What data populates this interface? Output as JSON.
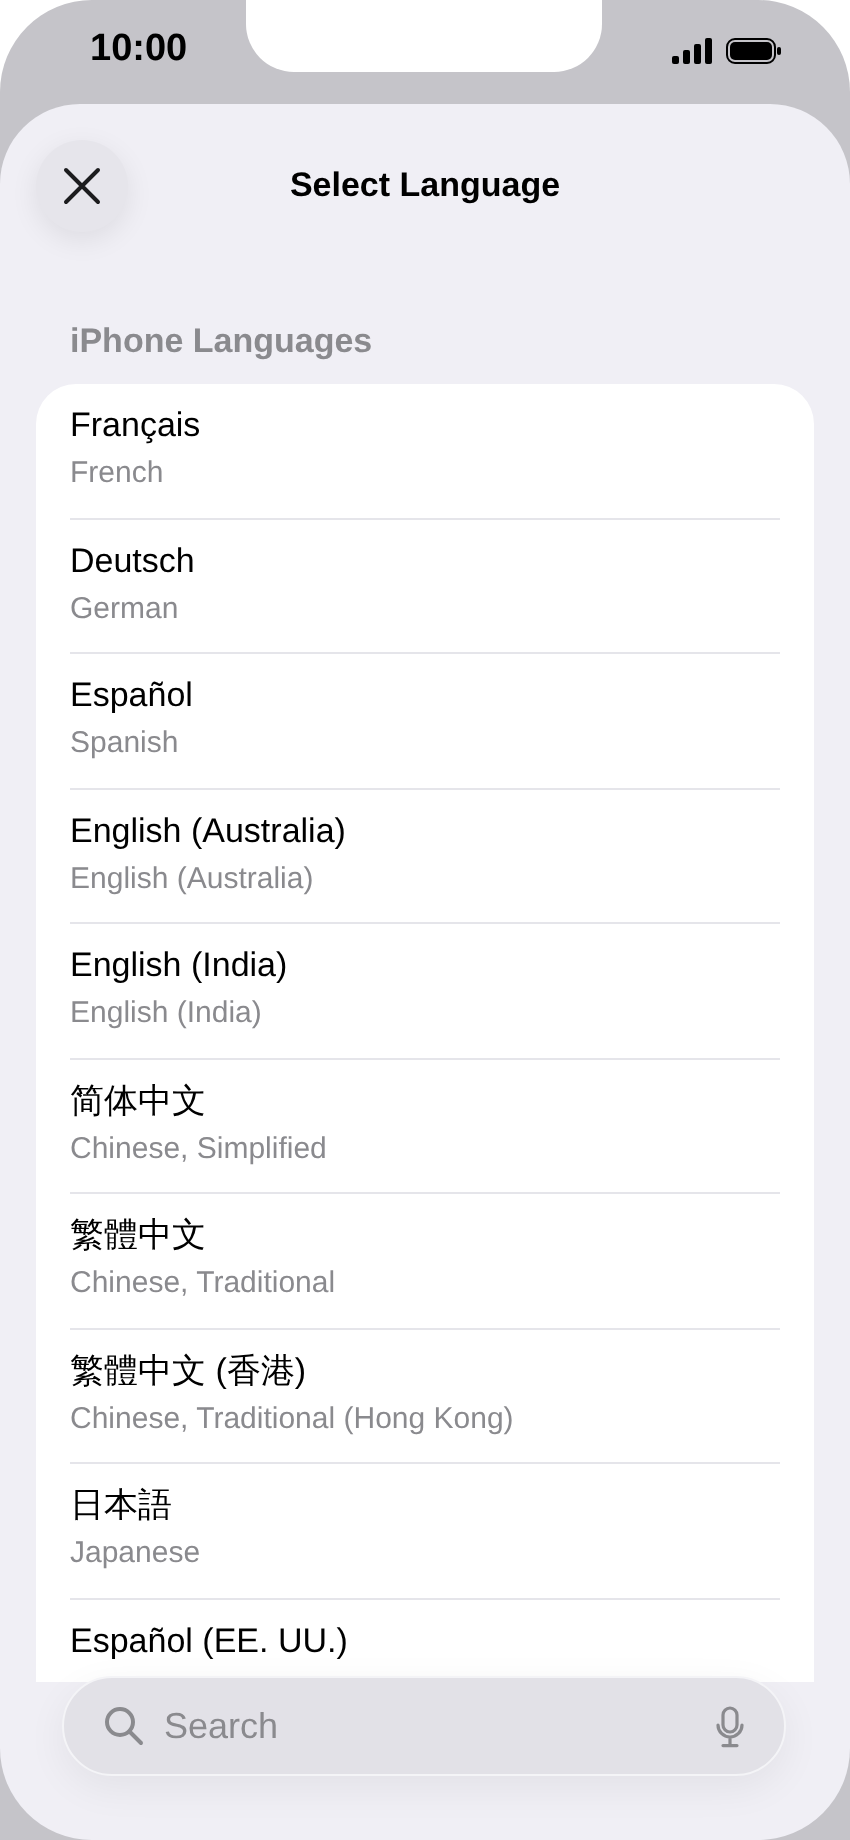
{
  "status_bar": {
    "time": "10:00"
  },
  "header": {
    "title": "Select Language"
  },
  "section": {
    "title": "iPhone Languages"
  },
  "languages": [
    {
      "name": "Français",
      "subtitle": "French"
    },
    {
      "name": "Deutsch",
      "subtitle": "German"
    },
    {
      "name": "Español",
      "subtitle": "Spanish"
    },
    {
      "name": "English (Australia)",
      "subtitle": "English (Australia)"
    },
    {
      "name": "English (India)",
      "subtitle": "English (India)"
    },
    {
      "name": "简体中文",
      "subtitle": "Chinese, Simplified"
    },
    {
      "name": "繁體中文",
      "subtitle": "Chinese, Traditional"
    },
    {
      "name": "繁體中文 (香港)",
      "subtitle": "Chinese, Traditional (Hong Kong)"
    },
    {
      "name": "日本語",
      "subtitle": "Japanese"
    },
    {
      "name": "Español (EE. UU.)"
    }
  ],
  "search": {
    "placeholder": "Search"
  }
}
